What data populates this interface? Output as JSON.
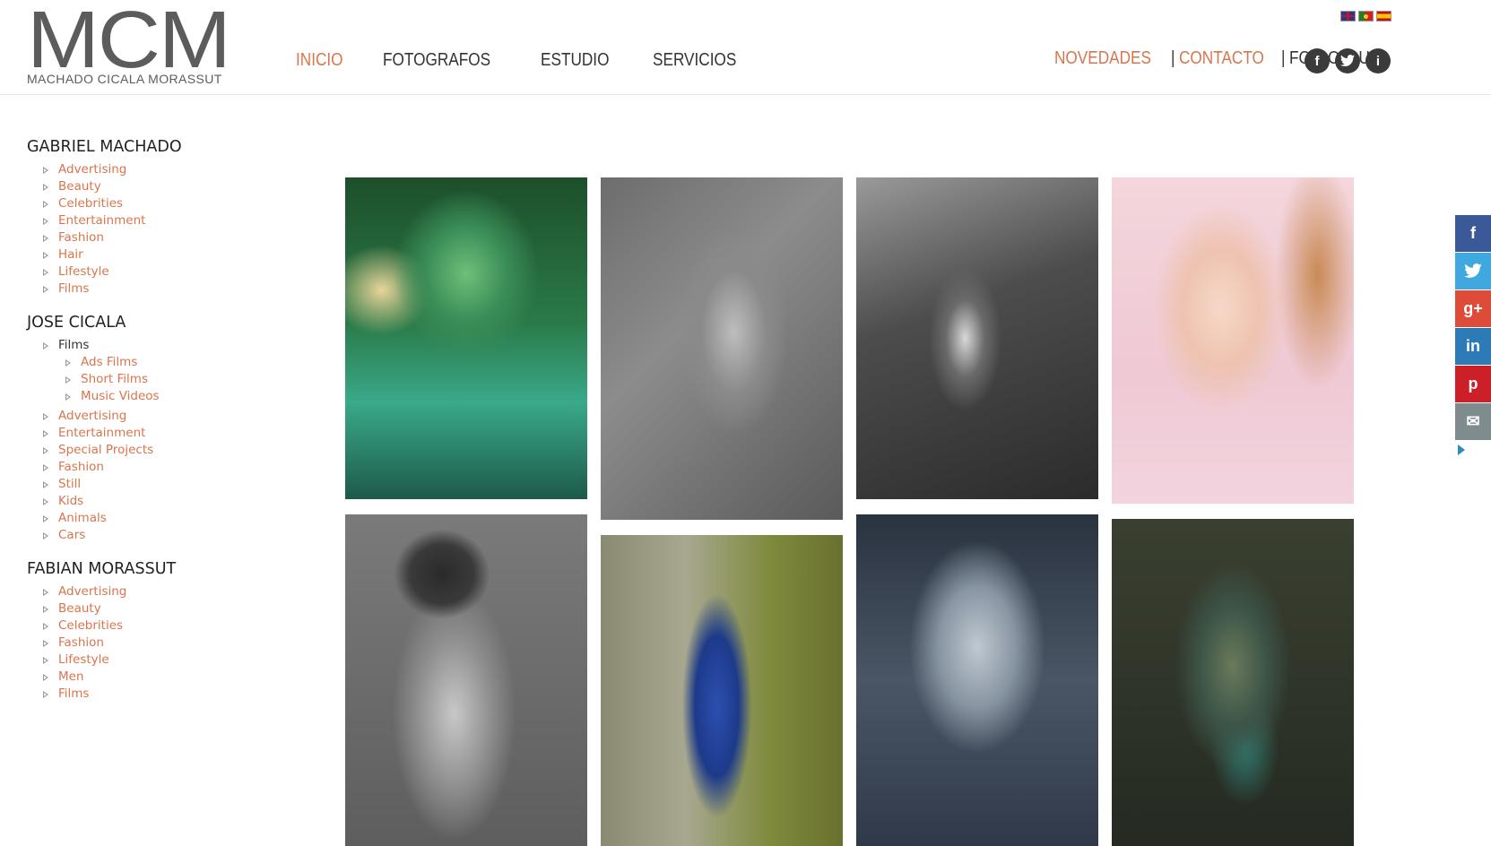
{
  "logo": {
    "mark": "MCM",
    "subtitle": "MACHADO CICALA MORASSUT"
  },
  "nav": {
    "items": [
      "INICIO",
      "FOTOGRAFOS",
      "ESTUDIO",
      "SERVICIOS"
    ],
    "active": "INICIO"
  },
  "top_right": {
    "novedades": "NOVEDADES",
    "separator": "|",
    "contacto": "CONTACTO",
    "follow": "FOLLOW US:"
  },
  "languages": [
    "english-flag",
    "portuguese-flag",
    "spanish-flag"
  ],
  "social_icons": [
    {
      "icon": "facebook-icon",
      "glyph": "f"
    },
    {
      "icon": "twitter-icon",
      "glyph": "t"
    },
    {
      "icon": "info-icon",
      "glyph": "i"
    }
  ],
  "sidebar": {
    "gabriel": {
      "name": "GABRIEL MACHADO",
      "items": [
        "Advertising",
        "Beauty",
        "Celebrities",
        "Entertainment",
        "Fashion",
        "Hair",
        "Lifestyle",
        "Films"
      ]
    },
    "jose": {
      "name": "JOSE CICALA",
      "films_label": "Films",
      "films_sub": [
        "Ads Films",
        "Short Films",
        "Music Videos"
      ],
      "items": [
        "Advertising",
        "Entertainment",
        "Special Projects",
        "Fashion",
        "Still",
        "Kids",
        "Animals",
        "Cars"
      ]
    },
    "fabian": {
      "name": "FABIAN MORASSUT",
      "items": [
        "Advertising",
        "Beauty",
        "Celebrities",
        "Fashion",
        "Lifestyle",
        "Men",
        "Films"
      ]
    }
  },
  "share": [
    {
      "icon": "facebook-share-icon",
      "glyph": "f",
      "color": "#3b5998"
    },
    {
      "icon": "twitter-share-icon",
      "glyph": "t",
      "color": "#3fa9df"
    },
    {
      "icon": "googleplus-share-icon",
      "glyph": "g+",
      "color": "#dd4b39"
    },
    {
      "icon": "linkedin-share-icon",
      "glyph": "in",
      "color": "#2c7bb6"
    },
    {
      "icon": "pinterest-share-icon",
      "glyph": "p",
      "color": "#cb2027"
    },
    {
      "icon": "email-share-icon",
      "glyph": "✉",
      "color": "#7f8c8d"
    }
  ],
  "colors": {
    "accent": "#d9754d",
    "text": "#222222"
  }
}
